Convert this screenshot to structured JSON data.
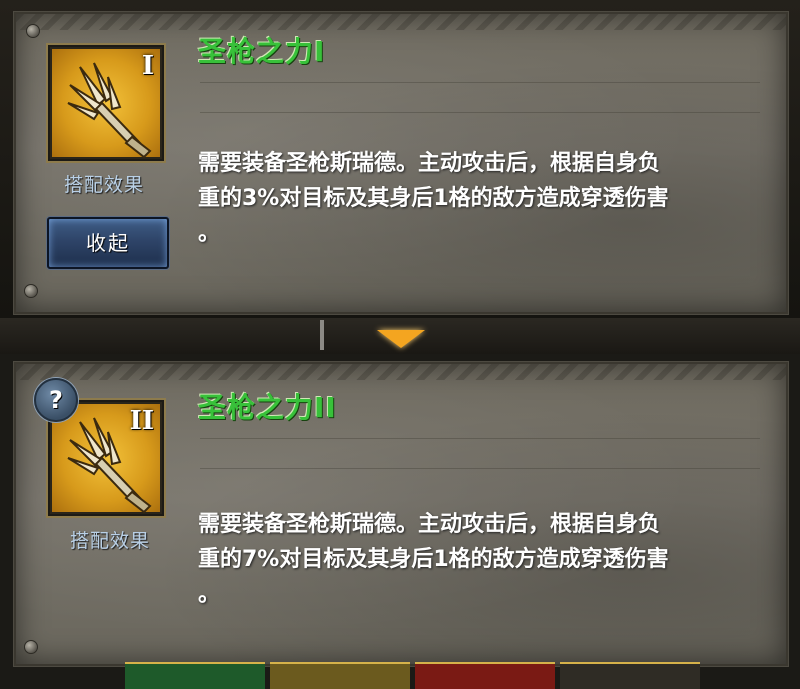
{
  "skills": [
    {
      "title": "圣枪之力I",
      "roman": "I",
      "effect_label": "搭配效果",
      "description_lines": [
        "需要装备圣枪斯瑞德。主动攻击后，根据自身负",
        "重的3%对目标及其身后1格的敌方造成穿透伤害",
        "。"
      ]
    },
    {
      "title": "圣枪之力II",
      "roman": "II",
      "effect_label": "搭配效果",
      "description_lines": [
        "需要装备圣枪斯瑞德。主动攻击后，根据自身负",
        "重的7%对目标及其身后1格的敌方造成穿透伤害",
        "。"
      ]
    }
  ],
  "collapse_button": {
    "label": "收起"
  },
  "help_button": {
    "label": "?"
  },
  "icons": {
    "skill_icon": "golden-spear-icon",
    "expand_indicator": "triangle-down-icon",
    "help": "question-mark-icon"
  },
  "colors": {
    "title_green": "#38c13a",
    "icon_gold": "#d79a1b",
    "label_blue": "#b9d0e6",
    "pointer_orange": "#f4a520"
  }
}
